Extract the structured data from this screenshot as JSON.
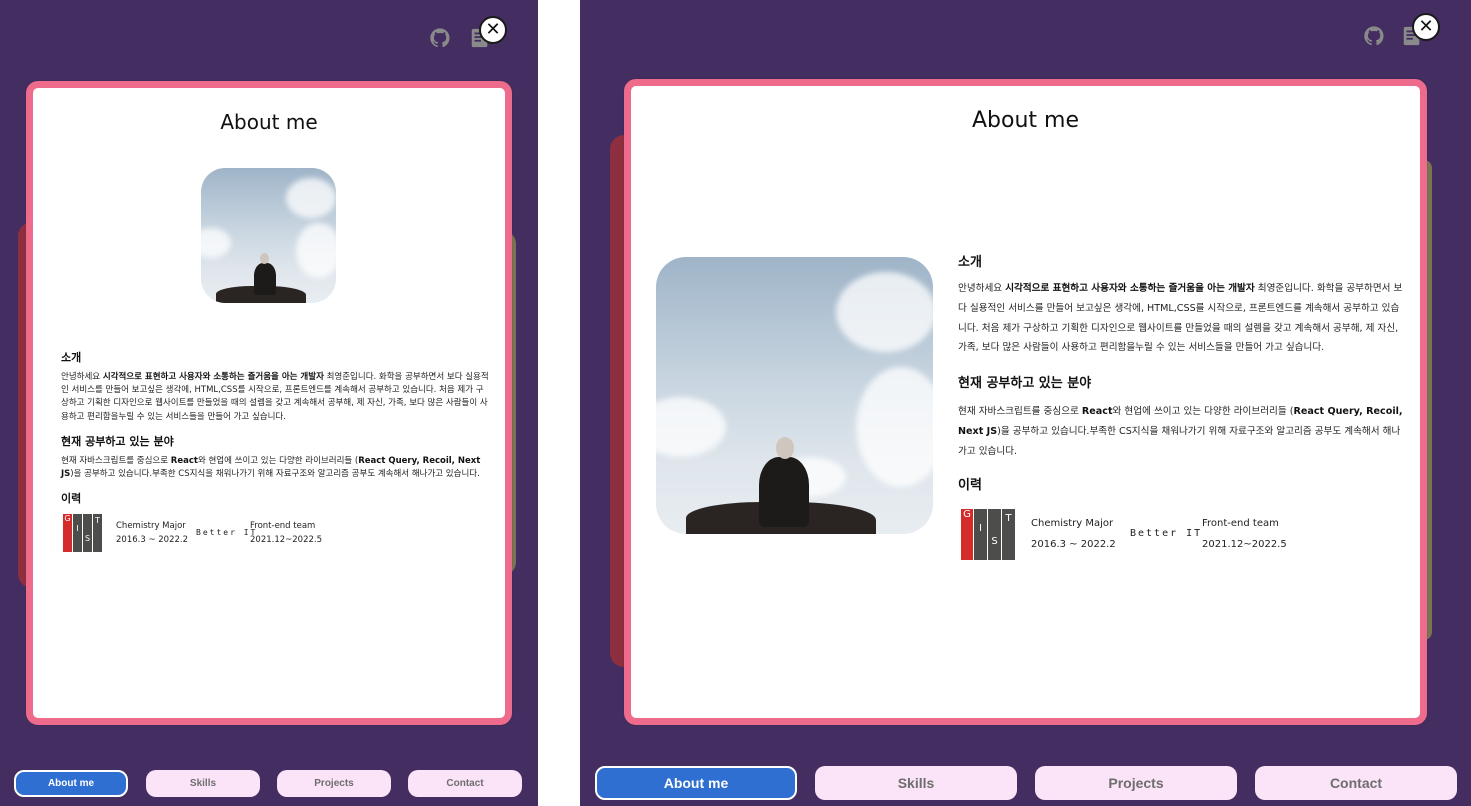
{
  "top_icons": {
    "github": "github-icon",
    "blog": "book-icon",
    "close_symbol": "✕"
  },
  "card": {
    "title": "About me"
  },
  "intro": {
    "heading": "소개",
    "text_before": "안녕하세요 ",
    "text_bold": "시각적으로 표현하고 사용자와 소통하는 즐거움을 아는 개발자",
    "text_after": " 최영준입니다. 화학을 공부하면서 보다 실용적인 서비스를 만들어 보고싶은 생각에, HTML,CSS를 시작으로, 프론트엔드를 계속해서 공부하고 있습니다. 처음 제가 구상하고 기획한 디자인으로 웹사이트를 만들었을 때의 설렘을 갖고 계속해서 공부해, 제 자신, 가족, 보다 많은 사람들이 사용하고 편리함을누릴 수 있는 서비스들을 만들어 가고 싶습니다."
  },
  "study": {
    "heading": "현재 공부하고 있는 분야",
    "text_1": "현재 자바스크립트를 중심으로 ",
    "bold_1": "React",
    "text_2": "와 현업에 쓰이고 있는 다양한 라이브러리들 (",
    "bold_2": "React Query, Recoil, Next JS",
    "text_3": ")을 공부하고 있습니다.부족한 CS지식을 채워나가기 위해 자료구조와 알고리즘 공부도 계속해서 해나가고 있습니다."
  },
  "history": {
    "heading": "이력",
    "gist_letters": [
      "G",
      "I",
      "S",
      "T"
    ],
    "major": "Chemistry Major",
    "major_period": "2016.3 ~ 2022.2",
    "better_it": "Better IT",
    "team": "Front-end team",
    "team_period": "2021.12~2022.5"
  },
  "nav": [
    "About me",
    "Skills",
    "Projects",
    "Contact"
  ],
  "colors": {
    "background": "#432d61",
    "card_border": "#ee6b8c",
    "nav_active": "#2e6fd1",
    "nav_inactive": "#fbe4f7"
  }
}
